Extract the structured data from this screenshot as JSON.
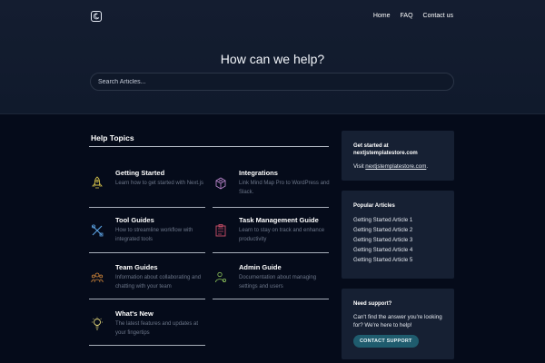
{
  "nav": {
    "items": [
      {
        "label": "Home"
      },
      {
        "label": "FAQ"
      },
      {
        "label": "Contact us"
      }
    ]
  },
  "hero": {
    "title": "How can we help?",
    "search_placeholder": "Search Articles..."
  },
  "topics": {
    "title": "Help Topics",
    "items": [
      {
        "title": "Getting Started",
        "desc": "Learn how to get started with Next.js",
        "icon": "rocket-icon",
        "color": "#d4c14a"
      },
      {
        "title": "Integrations",
        "desc": "Link Mind Map Pro to WordPress and Slack.",
        "icon": "cube-icon",
        "color": "#b884c9"
      },
      {
        "title": "Tool Guides",
        "desc": "How to streamline workflow with integrated tools",
        "icon": "tools-icon",
        "color": "#5aa0e0"
      },
      {
        "title": "Task Management Guide",
        "desc": "Learn to stay on track and enhance productivity",
        "icon": "task-icon",
        "color": "#d0506a"
      },
      {
        "title": "Team Guides",
        "desc": "Information about collaborating and chatting with your team",
        "icon": "team-icon",
        "color": "#d98a3a"
      },
      {
        "title": "Admin Guide",
        "desc": "Documentation about managing settings and users",
        "icon": "admin-icon",
        "color": "#8cc25a"
      },
      {
        "title": "What's New",
        "desc": "The latest features and updates at your fingertips",
        "icon": "bulb-icon",
        "color": "#e3d77a"
      }
    ]
  },
  "sidebar": {
    "get_started": {
      "title_line1": "Get started at",
      "title_line2": "nextjstemplatestore.com",
      "visit_prefix": "Visit ",
      "visit_link": "nextjstemplatestore.com",
      "visit_suffix": "."
    },
    "popular": {
      "title": "Popular Articles",
      "items": [
        "Getting Started Article 1",
        "Getting Started Article 2",
        "Getting Started Article 3",
        "Getting Started Article 4",
        "Getting Started Article 5"
      ]
    },
    "support": {
      "title": "Need support?",
      "text": "Can't find the answer you're looking for? We're here to help!",
      "button": "CONTACT SUPPORT"
    }
  }
}
